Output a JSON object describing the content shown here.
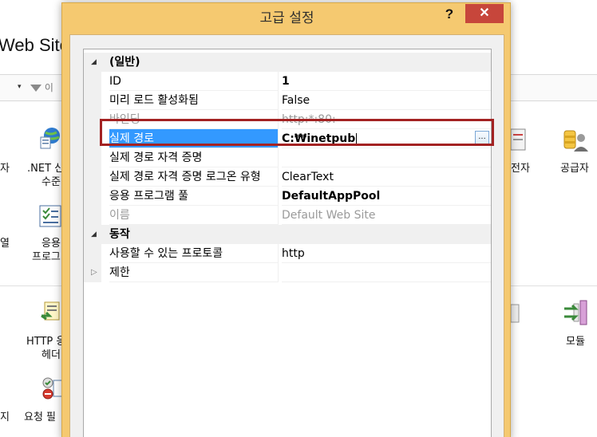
{
  "dialog": {
    "title": "고급 설정",
    "help": "?",
    "close": "✕"
  },
  "background": {
    "window_title": "Web Site",
    "filter_partial": "이",
    "dropdown_arrow": "▾",
    "labels": {
      "left_row1": "자",
      "net_line1": ".NET 신",
      "net_line2": "수준",
      "left_row2": "열",
      "app_line1": "응용",
      "app_line2": "프로그",
      "http_line1": "HTTP 응",
      "http_line2": "헤더",
      "left_row4": "지",
      "request": "요청 필",
      "cert_line1": "전자",
      "cert_line2": "",
      "provider": "공급자",
      "modules": "모듈",
      "right_mid": "",
      "right_low": "S"
    }
  },
  "property_grid": {
    "categories": [
      {
        "name": "(일반)",
        "expanded": true,
        "toggle": "◢",
        "properties": [
          {
            "name": "ID",
            "value": "1",
            "bold": true
          },
          {
            "name": "미리 로드 활성화됨",
            "value": "False"
          },
          {
            "name": "바인딩",
            "value": "http:*:80:",
            "disabled": true
          },
          {
            "name": "실제 경로",
            "value": "C:₩inetpub",
            "selected": true,
            "editing": true,
            "browse_label": "..."
          },
          {
            "name": "실제 경로 자격 증명",
            "value": ""
          },
          {
            "name": "실제 경로 자격 증명 로그온 유형",
            "value": "ClearText"
          },
          {
            "name": "응용 프로그램 풀",
            "value": "DefaultAppPool",
            "bold": true
          },
          {
            "name": "이름",
            "value": "Default Web Site",
            "disabled": true
          }
        ]
      },
      {
        "name": "동작",
        "expanded": true,
        "toggle": "◢",
        "properties": [
          {
            "name": "사용할 수 있는 프로토콜",
            "value": "http"
          },
          {
            "name": "제한",
            "value": "",
            "collapsed_toggle": "▷"
          }
        ]
      }
    ]
  },
  "colors": {
    "dialog_frame": "#f5c970",
    "close_button": "#c7463b",
    "selection": "#3399ff",
    "highlight_box": "#a32222"
  }
}
